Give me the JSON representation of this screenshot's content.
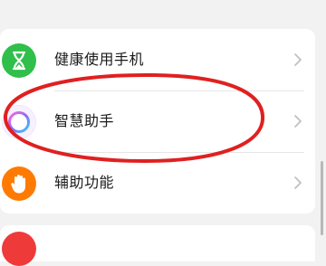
{
  "settings": {
    "items": [
      {
        "label": "健康使用手机",
        "icon": "hourglass-icon",
        "color": "#2fbf4a"
      },
      {
        "label": "智慧助手",
        "icon": "assistant-ring-icon",
        "color": "#9b6dff"
      },
      {
        "label": "辅助功能",
        "icon": "hand-icon",
        "color": "#ff7a00"
      }
    ]
  },
  "annotation": {
    "color": "#e02020",
    "shape": "ellipse"
  },
  "colors": {
    "background": "#f2f2f2",
    "card": "#ffffff",
    "text": "#1a1a1a",
    "chevron": "#bdbdbd"
  }
}
